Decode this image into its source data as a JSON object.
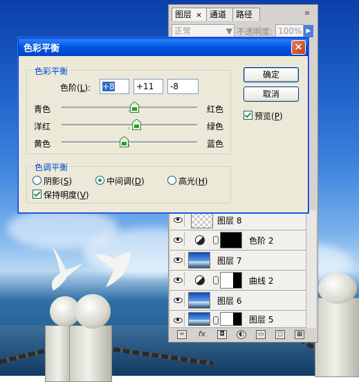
{
  "layers_panel": {
    "tabs": [
      {
        "label": "图层",
        "active": true
      },
      {
        "label": "通道"
      },
      {
        "label": "路径"
      }
    ],
    "tab_close": "×",
    "blend_mode": "正常",
    "opacity_label": "不透明度:",
    "opacity_value": "100%",
    "layers": [
      {
        "name": "图层 8",
        "thumb": "transparent"
      },
      {
        "name": "色阶 2",
        "thumb": "black",
        "adjustment": true
      },
      {
        "name": "图层 7",
        "thumb": "sky"
      },
      {
        "name": "曲线 2",
        "thumb": "mask",
        "adjustment": true
      },
      {
        "name": "图层 6",
        "thumb": "sky"
      },
      {
        "name": "图层 5",
        "thumb": "sky",
        "mask": true
      }
    ],
    "bottom_icons": [
      "link-icon",
      "fx-icon",
      "add-mask-icon",
      "adjustment-layer-icon",
      "new-group-icon",
      "new-layer-icon",
      "trash-icon"
    ],
    "fx_label": "fx"
  },
  "dialog": {
    "title": "色彩平衡",
    "close_glyph": "×",
    "color_balance_group": "色彩平衡",
    "levels_label": "色阶(",
    "levels_hotkey": "L",
    "levels_suffix": "):",
    "level_values": [
      "+8",
      "+11",
      "-8"
    ],
    "sliders": [
      {
        "left": "青色",
        "right": "红色",
        "value": 8
      },
      {
        "left": "洋红",
        "right": "绿色",
        "value": 11
      },
      {
        "left": "黄色",
        "right": "蓝色",
        "value": -8
      }
    ],
    "tone_group": "色调平衡",
    "tones": [
      {
        "label": "阴影",
        "hotkey": "S",
        "selected": false
      },
      {
        "label": "中间调",
        "hotkey": "D",
        "selected": true
      },
      {
        "label": "高光",
        "hotkey": "H",
        "selected": false
      }
    ],
    "preserve_label": "保持明度",
    "preserve_hotkey": "V",
    "preserve_checked": true,
    "ok_label": "确定",
    "cancel_label": "取消",
    "preview_label": "预览",
    "preview_hotkey": "P",
    "preview_checked": true
  },
  "colors": {
    "title_blue": "#0054e3",
    "group_label_blue": "#0046d5",
    "close_red": "#c43d18"
  }
}
